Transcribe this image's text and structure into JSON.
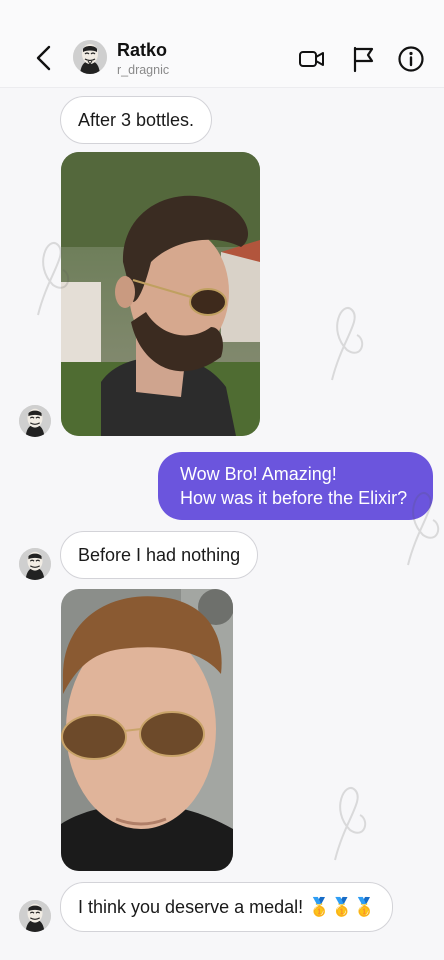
{
  "header": {
    "contact_name": "Ratko",
    "contact_username": "r_dragnic",
    "icons": [
      "chevron-left-icon",
      "video-call-icon",
      "flag-icon",
      "info-icon"
    ]
  },
  "messages": [
    {
      "direction": "incoming",
      "type": "text",
      "text": "After 3 bottles."
    },
    {
      "direction": "incoming",
      "type": "photo",
      "description": "man with beard and aviator sunglasses"
    },
    {
      "direction": "outgoing",
      "type": "text",
      "lines": [
        "Wow Bro! Amazing!",
        "How was it before the Elixir?"
      ]
    },
    {
      "direction": "incoming",
      "type": "text",
      "text": "Before I had nothing"
    },
    {
      "direction": "incoming",
      "type": "photo",
      "description": "young man selfie with aviator sunglasses"
    },
    {
      "direction": "incoming",
      "type": "text",
      "text": "I think you deserve a medal! 🥇🥇🥇"
    }
  ],
  "colors": {
    "outgoing_bubble": "#6b55dd",
    "incoming_bubble": "#ffffff",
    "background": "#f7f7f9"
  }
}
